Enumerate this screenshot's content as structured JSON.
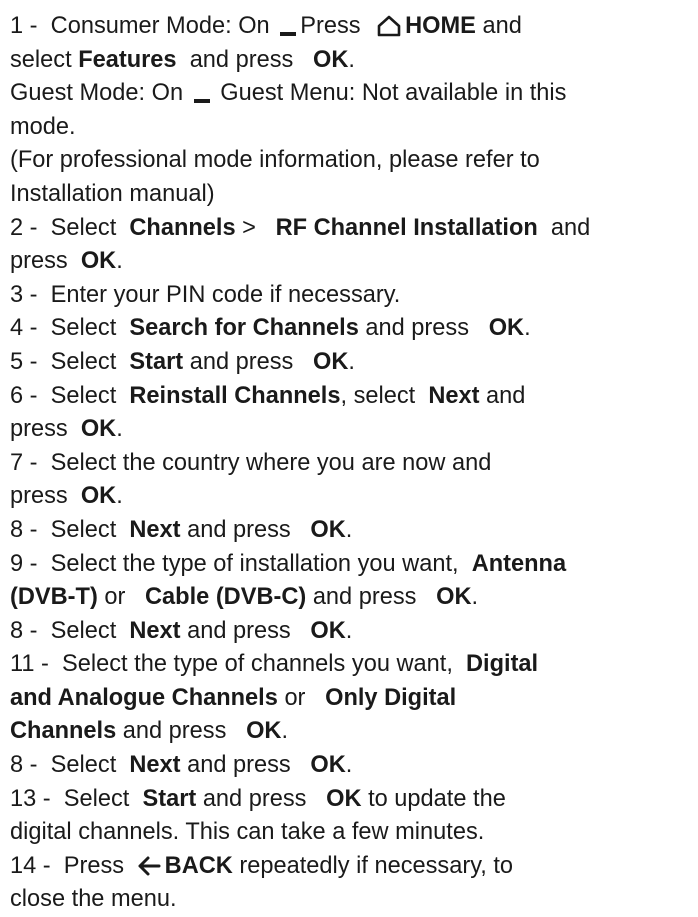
{
  "step1": {
    "num": "1 -",
    "consumer_label": "Consumer Mode: On",
    "press": "Press",
    "home": "HOME",
    "and": "and",
    "select": "select",
    "features": "Features",
    "and_press": "and press",
    "ok": "OK",
    "period": ".",
    "guest_label": "Guest Mode: On",
    "guest_text": "Guest Menu: Not available in this",
    "guest_text2": "mode.",
    "pro_line1": "(For professional mode information, please refer to",
    "pro_line2": "Installation manual)"
  },
  "step2": {
    "num": "2 -",
    "select": "Select",
    "channels": "Channels",
    "gt": ">",
    "rf": "RF Channel Installation",
    "and": "and",
    "press": "press",
    "ok": "OK",
    "period": "."
  },
  "step3": {
    "text": "3 -  Enter your PIN code if necessary."
  },
  "step4": {
    "num": "4 -",
    "select": "Select",
    "item": "Search for Channels",
    "and_press": "and press",
    "ok": "OK",
    "period": "."
  },
  "step5": {
    "num": "5 -",
    "select": "Select",
    "item": "Start",
    "and_press": "and press",
    "ok": "OK",
    "period": "."
  },
  "step6": {
    "num": "6 -",
    "select": "Select",
    "item": "Reinstall Channels",
    "select2": ", select",
    "next": "Next",
    "and": "and",
    "press": "press",
    "ok": "OK",
    "period": "."
  },
  "step7": {
    "line1": "7 -  Select the country where you are now and",
    "press": "press",
    "ok": "OK",
    "period": "."
  },
  "step8a": {
    "num": "8 -",
    "select": "Select",
    "item": "Next",
    "and_press": "and press",
    "ok": "OK",
    "period": "."
  },
  "step9": {
    "num": "9 -",
    "text": "Select the type of installation you want,",
    "antenna": "Antenna",
    "dvbt": "(DVB-T)",
    "or": "or",
    "cable": "Cable (DVB-C)",
    "and_press": "and press",
    "ok": "OK",
    "period": "."
  },
  "step8b": {
    "num": "8 -",
    "select": "Select",
    "item": "Next",
    "and_press": "and press",
    "ok": "OK",
    "period": "."
  },
  "step11": {
    "num": "11 -",
    "text": "Select the type of channels you want,",
    "digital": "Digital",
    "and_analogue": "and Analogue Channels",
    "or": "or",
    "only_digital": "Only Digital",
    "channels": "Channels",
    "and_press": "and press",
    "ok": "OK",
    "period": "."
  },
  "step8c": {
    "num": "8 -",
    "select": "Select",
    "item": "Next",
    "and_press": "and press",
    "ok": "OK",
    "period": "."
  },
  "step13": {
    "num": "13 -",
    "select": "Select",
    "item": "Start",
    "and_press": "and press",
    "ok": "OK",
    "tail": "to update the",
    "line2": "digital channels. This can take a few minutes."
  },
  "step14": {
    "num": "14 -",
    "press": "Press",
    "back": "BACK",
    "tail": "repeatedly if necessary, to",
    "line2": "close the menu."
  },
  "icons": {
    "home": "home-icon",
    "dash": "dash-icon",
    "back": "back-arrow-icon"
  }
}
